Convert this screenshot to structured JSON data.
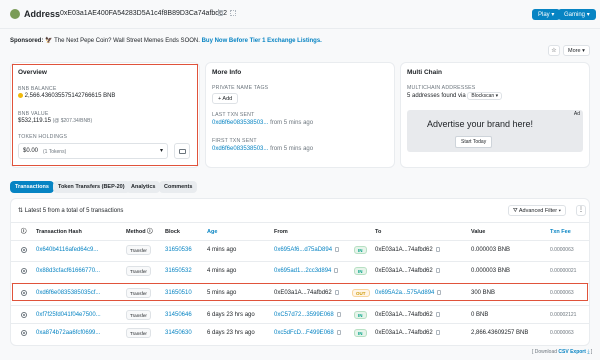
{
  "header": {
    "title": "Address",
    "address": "0xE03a1AE400FA54283D5A1c4f8B89D3Ca74afbd62",
    "play_label": "Play",
    "gaming_label": "Gaming"
  },
  "sponsored": {
    "label": "Sponsored:",
    "text": "The Next Pepe Coin? Wall Street Memes Ends SOON.",
    "cta": "Buy Now Before Tier 1 Exchange Listings."
  },
  "toolbar": {
    "more_label": "More"
  },
  "overview": {
    "title": "Overview",
    "bnb_balance_label": "BNB BALANCE",
    "bnb_balance_value": "2,566.436035575142766615 BNB",
    "bnb_value_label": "BNB VALUE",
    "bnb_value_value": "$532,119.15",
    "bnb_value_rate": "(@ $207.34/BNB)",
    "token_holdings_label": "TOKEN HOLDINGS",
    "token_holdings_value": "$0.00",
    "token_holdings_count": "(1 Tokens)"
  },
  "more_info": {
    "title": "More Info",
    "private_tags_label": "PRIVATE NAME TAGS",
    "add_label": "+ Add",
    "last_txn_label": "LAST TXN SENT",
    "last_txn_hash": "0xd6f6e083538503...",
    "last_txn_time": "from 5 mins ago",
    "first_txn_label": "FIRST TXN SENT",
    "first_txn_hash": "0xd6f6e083538503...",
    "first_txn_time": "from 5 mins ago"
  },
  "multichain": {
    "title": "Multi Chain",
    "addresses_label": "MULTICHAIN ADDRESSES",
    "addresses_value": "5 addresses found via",
    "blockscan": "Blockscan",
    "ad_badge": "Ad",
    "ad_text": "Advertise your brand here!",
    "ad_button": "Start Today"
  },
  "tabs": [
    {
      "label": "Transactions"
    },
    {
      "label": "Token Transfers (BEP-20)"
    },
    {
      "label": "Analytics"
    },
    {
      "label": "Comments"
    }
  ],
  "transactions": {
    "summary": "Latest 5 from a total of 5 transactions",
    "advanced_filter": "Advanced Filter",
    "columns": [
      "Transaction Hash",
      "Method",
      "Block",
      "Age",
      "From",
      "To",
      "Value",
      "Txn Fee"
    ],
    "rows": [
      {
        "hash": "0x640b4116afed64c9...",
        "method": "Transfer",
        "block": "31650536",
        "age": "4 mins ago",
        "from": "0x695Af6...d75aD894",
        "dir": "IN",
        "to": "0xE03a1A...74afbd62",
        "value": "0.000003 BNB",
        "fee": "0.0000063"
      },
      {
        "hash": "0x88d3cfacf61666770...",
        "method": "Transfer",
        "block": "31650532",
        "age": "4 mins ago",
        "from": "0x695ad1...2cc3d894",
        "dir": "IN",
        "to": "0xE03a1A...74afbd62",
        "value": "0.000003 BNB",
        "fee": "0.00000021"
      },
      {
        "hash": "0xd6f6e0835385035cf...",
        "method": "Transfer",
        "block": "31650510",
        "age": "5 mins ago",
        "from": "0xE03a1A...74afbd62",
        "dir": "OUT",
        "to": "0x695A2a...575Ad894",
        "value": "300 BNB",
        "fee": "0.0000063"
      },
      {
        "hash": "0xf7f25fd041f04e7500...",
        "method": "Transfer",
        "block": "31450646",
        "age": "6 days 23 hrs ago",
        "from": "0xC57d72...3599E068",
        "dir": "IN",
        "to": "0xE03a1A...74afbd62",
        "value": "0 BNB",
        "fee": "0.00002121"
      },
      {
        "hash": "0xa874b72aa6fcf0699...",
        "method": "Transfer",
        "block": "31450630",
        "age": "6 days 23 hrs ago",
        "from": "0xc5dFcD...F499E068",
        "dir": "IN",
        "to": "0xE03a1A...74afbd62",
        "value": "2,866.43609257 BNB",
        "fee": "0.0000063"
      }
    ]
  },
  "footer": {
    "download_label": "[ Download",
    "export_label": "CSV Export",
    "close_bracket": "]"
  },
  "colors": {
    "accent": "#0784c3",
    "highlight": "#e0533b",
    "in": "#00a186",
    "out": "#cc9a06"
  }
}
